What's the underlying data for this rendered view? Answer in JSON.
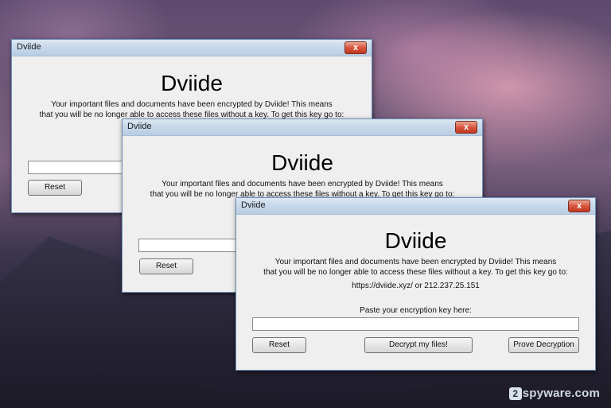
{
  "desktop": {
    "watermark_badge": "2",
    "watermark_text": "spyware.com"
  },
  "window1": {
    "title": "Dviide",
    "close_glyph": "x",
    "heading": "Dviide",
    "message_line1": "Your important files and documents have been encrypted by Dviide! This means",
    "message_line2": "that you will be no longer able to access these files without a key. To get this key go to:",
    "reset_label": "Reset"
  },
  "window2": {
    "title": "Dviide",
    "close_glyph": "x",
    "heading": "Dviide",
    "message_line1": "Your important files and documents have been encrypted by Dviide! This means",
    "message_line2": "that you will be no longer able to access these files without a key. To get this key go to:",
    "reset_label": "Reset"
  },
  "window3": {
    "title": "Dviide",
    "close_glyph": "x",
    "heading": "Dviide",
    "message_line1": "Your important files and documents have been encrypted by Dviide! This means",
    "message_line2": "that you will be no longer able to access these files without a key. To get this key go to:",
    "address": "https://dviide.xyz/ or 212.237.25.151",
    "paste_label": "Paste your encryption key here:",
    "key_value": "",
    "reset_label": "Reset",
    "decrypt_label": "Decrypt my files!",
    "prove_label": "Prove Decryption"
  },
  "colors": {
    "close_button": "#d8563f",
    "titlebar": "#c7d8ea",
    "client": "#efefef"
  }
}
